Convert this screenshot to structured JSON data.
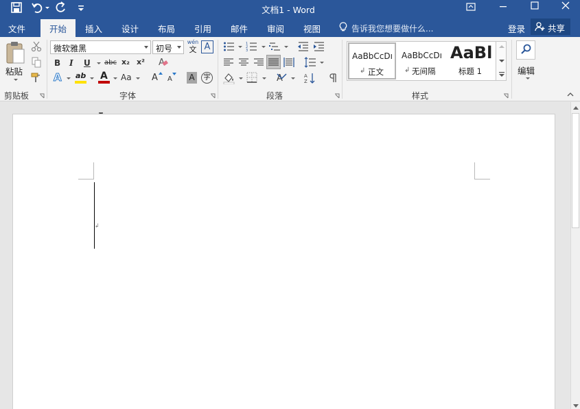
{
  "window": {
    "title": "文档1 - Word",
    "accent": "#2b579a"
  },
  "tabs": {
    "file": "文件",
    "home": "开始",
    "insert": "插入",
    "design": "设计",
    "layout": "布局",
    "references": "引用",
    "mailings": "邮件",
    "review": "审阅",
    "view": "视图"
  },
  "tell_me": {
    "placeholder": "告诉我您想要做什么..."
  },
  "account": {
    "signin": "登录",
    "share": "共享"
  },
  "clipboard": {
    "paste": "粘贴",
    "group_label": "剪贴板"
  },
  "font": {
    "name": "微软雅黑",
    "size": "初号",
    "group_label": "字体",
    "bold": "B",
    "italic": "I",
    "underline": "U",
    "strike": "abc",
    "subscript": "x₂",
    "superscript": "x²",
    "grow": "A",
    "shrink": "A",
    "case": "Aa",
    "phonetic_top": "wén",
    "phonetic_bottom": "文",
    "border_char": "A",
    "shade_char": "A",
    "enclose_char": "字",
    "effects": "A",
    "highlight": "ab",
    "color": "A"
  },
  "paragraph": {
    "group_label": "段落"
  },
  "styles": {
    "group_label": "样式",
    "items": [
      {
        "preview": "AaBbCcDı",
        "name": "正文",
        "mark": "↲"
      },
      {
        "preview": "AaBbCcDı",
        "name": "无间隔",
        "mark": "↲"
      },
      {
        "preview": "AaBl",
        "name": "标题 1",
        "mark": ""
      }
    ]
  },
  "editing": {
    "label": "编辑"
  },
  "document": {
    "paragraph_mark": "↲"
  }
}
